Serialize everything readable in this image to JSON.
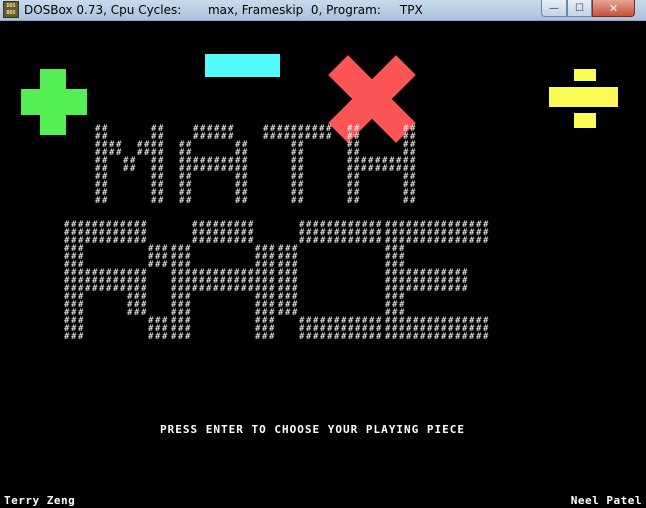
{
  "window": {
    "title": "DOSBox 0.73, Cpu Cycles:       max, Frameskip  0, Program:     TPX",
    "app_icon_text": "DOS BOX",
    "minimize_glyph": "—",
    "maximize_glyph": "☐",
    "close_glyph": "✕"
  },
  "game": {
    "title_line1": "MATH",
    "title_line2": "RACE",
    "logo_fill_glyph": "#",
    "operator_icons": [
      "plus-icon",
      "minus-icon",
      "times-icon",
      "divide-icon"
    ],
    "operator_colors": {
      "plus": "#55ef55",
      "minus": "#55fbfb",
      "times": "#fb5555",
      "divide": "#fbfb55"
    },
    "prompt": "PRESS ENTER TO CHOOSE YOUR PLAYING PIECE",
    "credit_left": "Terry Zeng",
    "credit_right": "Neel Patel"
  }
}
